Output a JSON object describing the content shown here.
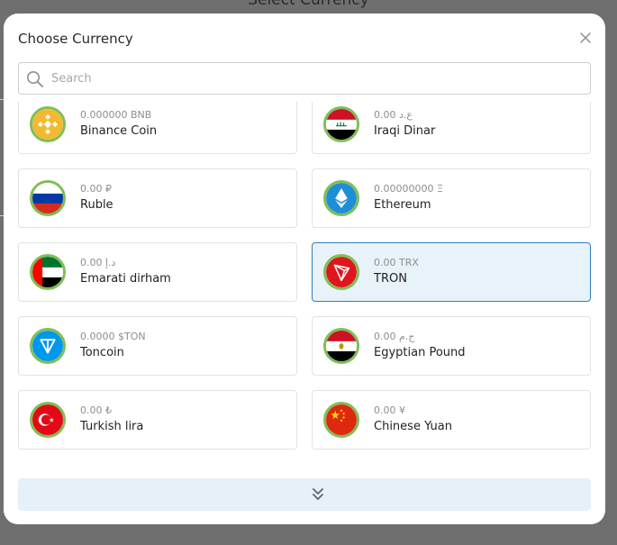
{
  "backdrop": {
    "title": "Select Currency"
  },
  "modal": {
    "title": "Choose Currency",
    "search": {
      "placeholder": "Search",
      "value": ""
    }
  },
  "currencies": [
    {
      "amount": "0.000000 BNB",
      "name": "Binance Coin",
      "icon": "binance-coin-icon",
      "selected": false
    },
    {
      "amount": "0.00 ع.د",
      "name": "Iraqi Dinar",
      "icon": "iraq-flag-icon",
      "selected": false
    },
    {
      "amount": "0.00 ₽",
      "name": "Ruble",
      "icon": "russia-flag-icon",
      "selected": false
    },
    {
      "amount": "0.00000000 Ξ",
      "name": "Ethereum",
      "icon": "ethereum-icon",
      "selected": false
    },
    {
      "amount": "د.إ 0.00",
      "name": "Emarati dirham",
      "icon": "uae-flag-icon",
      "selected": false
    },
    {
      "amount": "0.00 TRX",
      "name": "TRON",
      "icon": "tron-icon",
      "selected": true
    },
    {
      "amount": "0.0000 $TON",
      "name": "Toncoin",
      "icon": "toncoin-icon",
      "selected": false
    },
    {
      "amount": "0.00 ج.م",
      "name": "Egyptian Pound",
      "icon": "egypt-flag-icon",
      "selected": false
    },
    {
      "amount": "0.00 ₺",
      "name": "Turkish lira",
      "icon": "turkey-flag-icon",
      "selected": false
    },
    {
      "amount": "0.00 ¥",
      "name": "Chinese Yuan",
      "icon": "china-flag-icon",
      "selected": false
    }
  ],
  "colors": {
    "accent": "#2f7fbf",
    "selected_bg": "#e8f2f9",
    "coin_ring": "#7fbe57",
    "load_more_bg": "#e5f0f8"
  },
  "load_more": {
    "icon": "chevrons-down-icon"
  }
}
